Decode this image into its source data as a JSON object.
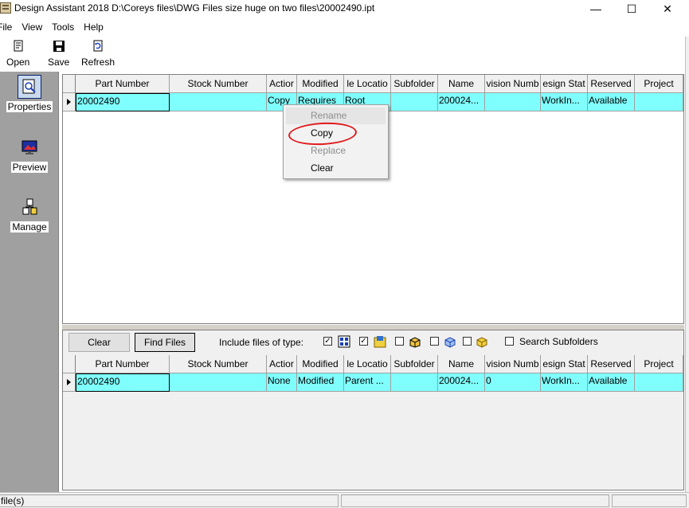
{
  "window": {
    "title": "Design Assistant 2018 D:\\Coreys files\\DWG Files size huge on two files\\20002490.ipt",
    "minimize": "—",
    "maximize": "☐",
    "close": "✕"
  },
  "menu": [
    "File",
    "View",
    "Tools",
    "Help"
  ],
  "toolbar": {
    "open": "Open",
    "save": "Save",
    "refresh": "Refresh"
  },
  "sidebar": [
    {
      "label": "Properties",
      "icon": "properties-icon"
    },
    {
      "label": "Preview",
      "icon": "preview-icon"
    },
    {
      "label": "Manage",
      "icon": "manage-icon"
    }
  ],
  "columns": [
    "Part Number",
    "Stock Number",
    "Action",
    "Modified",
    "File Location",
    "Subfolder",
    "Name",
    "Revision Number",
    "Design State",
    "Reserved",
    "Project"
  ],
  "column_headers_visible": [
    "Part Number",
    "Stock Number",
    "Actior",
    "Modified",
    "le Locatio",
    "Subfolder",
    "Name",
    "vision Numb",
    "esign Stat",
    "Reserved",
    "Project"
  ],
  "top_grid": {
    "rows": [
      [
        "20002490",
        "",
        "Copy",
        "Requires",
        "Root",
        "",
        "200024...",
        "",
        "WorkIn...",
        "Available",
        ""
      ]
    ]
  },
  "bottom_controls": {
    "clear": "Clear",
    "find_files": "Find Files",
    "include_label": "Include files of type:",
    "include_checks": [
      "✓",
      "✓",
      "",
      "",
      "",
      ""
    ],
    "search_subfolders": "Search Subfolders"
  },
  "bottom_grid": {
    "rows": [
      [
        "20002490",
        "",
        "None",
        "Modified",
        "Parent ...",
        "",
        "200024...",
        "0",
        "WorkIn...",
        "Available",
        ""
      ]
    ]
  },
  "context_menu": {
    "rename": "Rename",
    "copy": "Copy",
    "replace": "Replace",
    "clear": "Clear"
  },
  "status": {
    "left": "file(s)",
    "middle": "",
    "right": ""
  },
  "colors": {
    "row_highlight": "#80ffff",
    "annotation": "#e0191c",
    "sidebar_bg": "#a0a0a0"
  }
}
